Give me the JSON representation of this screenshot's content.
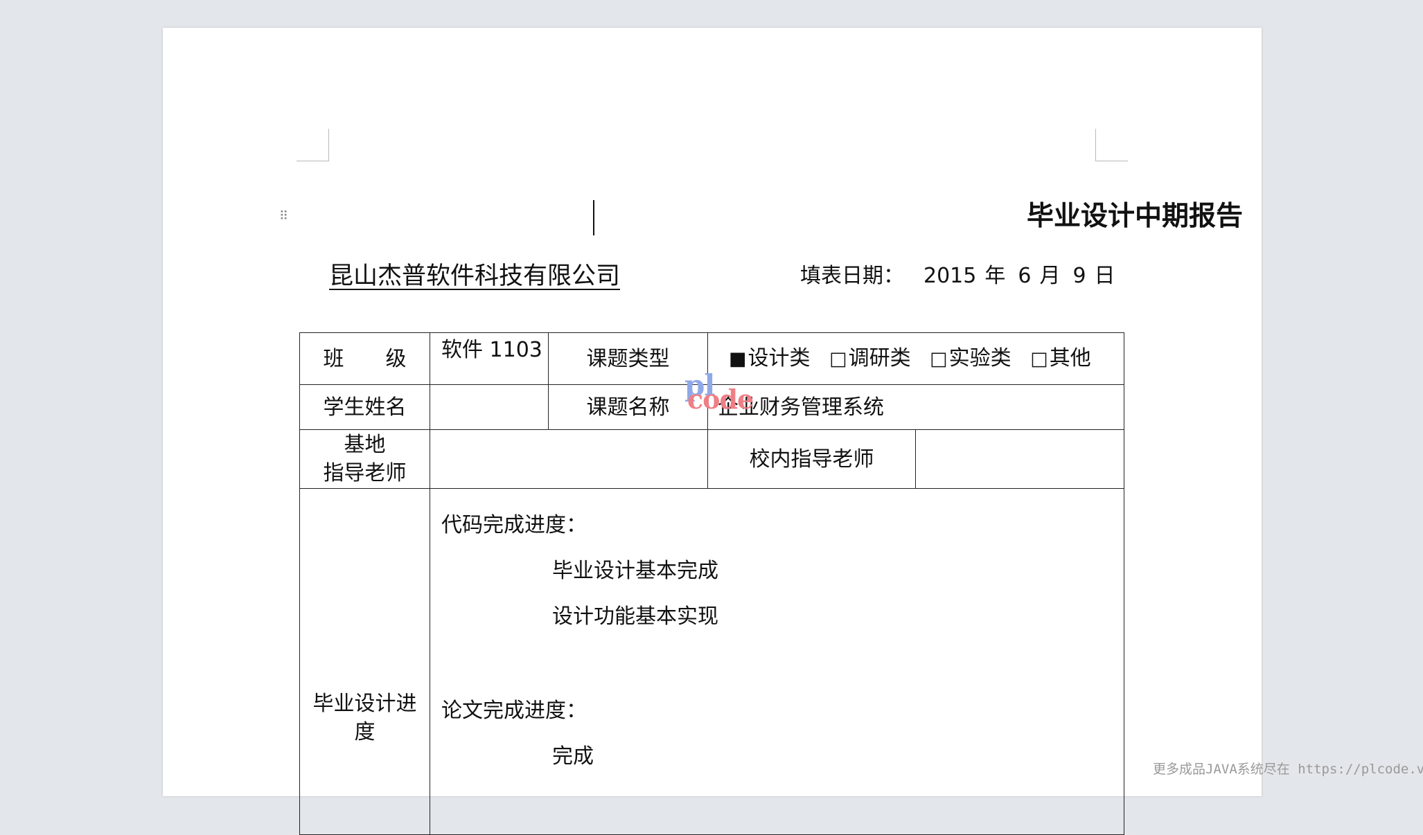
{
  "document": {
    "title": "毕业设计中期报告",
    "company": "昆山杰普软件科技有限公司",
    "fill_date": {
      "label": "填表日期：",
      "year": "2015",
      "year_unit": "年",
      "month": "6",
      "month_unit": "月",
      "day": "9",
      "day_unit": "日"
    }
  },
  "form": {
    "row1": {
      "class_label": "班　　级",
      "class_value": "软件 1103",
      "topic_type_label": "课题类型",
      "topic_types": [
        {
          "box": "■",
          "label": "设计类"
        },
        {
          "box": "□",
          "label": "调研类"
        },
        {
          "box": "□",
          "label": "实验类"
        },
        {
          "box": "□",
          "label": "其他"
        }
      ]
    },
    "row2": {
      "student_name_label": "学生姓名",
      "student_name_value": "",
      "topic_name_label": "课题名称",
      "topic_name_value": "企业财务管理系统"
    },
    "row3": {
      "base_advisor_label_line1": "基地",
      "base_advisor_label_line2": "指导老师",
      "base_advisor_value": "",
      "school_advisor_label": "校内指导老师",
      "school_advisor_value": ""
    },
    "row4": {
      "label_line1": "毕业设计进",
      "label_line2": "度",
      "code_progress_label": "代码完成进度：",
      "code_progress_lines": [
        "毕业设计基本完成",
        "设计功能基本实现"
      ],
      "thesis_progress_label": "论文完成进度：",
      "thesis_progress_value": "完成"
    }
  },
  "watermark": {
    "top": "pl",
    "bottom": "code"
  },
  "footer": {
    "note": "更多成品JAVA系统尽在 https://plcode.vip"
  }
}
